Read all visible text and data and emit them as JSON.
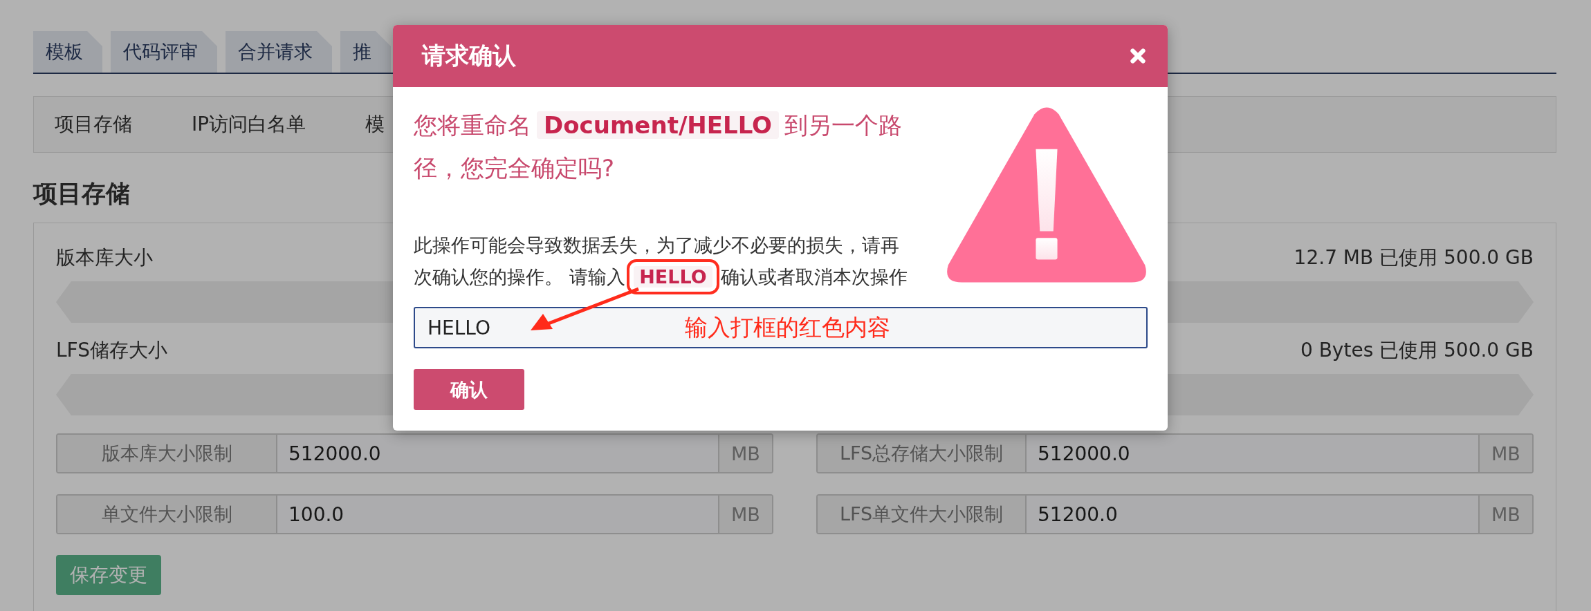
{
  "tabs": [
    {
      "label": "模板"
    },
    {
      "label": "代码评审"
    },
    {
      "label": "合并请求"
    },
    {
      "label": "推"
    }
  ],
  "subnav": [
    "项目存储",
    "IP访问白名单",
    "模"
  ],
  "section_title": "项目存储",
  "usage": [
    {
      "label": "版本库大小",
      "reading": "12.7 MB 已使用 500.0 GB",
      "level": 0
    },
    {
      "label": "LFS储存大小",
      "reading": "0 Bytes 已使用 500.0 GB",
      "level": 0
    }
  ],
  "limits": [
    {
      "label": "版本库大小限制",
      "value": "512000.0",
      "unit": "MB"
    },
    {
      "label": "LFS总存储大小限制",
      "value": "512000.0",
      "unit": "MB"
    },
    {
      "label": "单文件大小限制",
      "value": "100.0",
      "unit": "MB"
    },
    {
      "label": "LFS单文件大小限制",
      "value": "51200.0",
      "unit": "MB"
    }
  ],
  "save_button": "保存变更",
  "dialog": {
    "title": "请求确认",
    "headline": {
      "before": "您将重命名",
      "code": "Document/HELLO",
      "after": "到另一个路径，您完全确定吗?"
    },
    "message": {
      "before": "此操作可能会导致数据丢失，为了减少不必要的损失，请再次确认您的操作。 请输入",
      "code": "HELLO",
      "after": "确认或者取消本次操作"
    },
    "input_value": "HELLO",
    "confirm_button": "确认"
  },
  "annotation": {
    "text": "输入打框的红色内容"
  }
}
